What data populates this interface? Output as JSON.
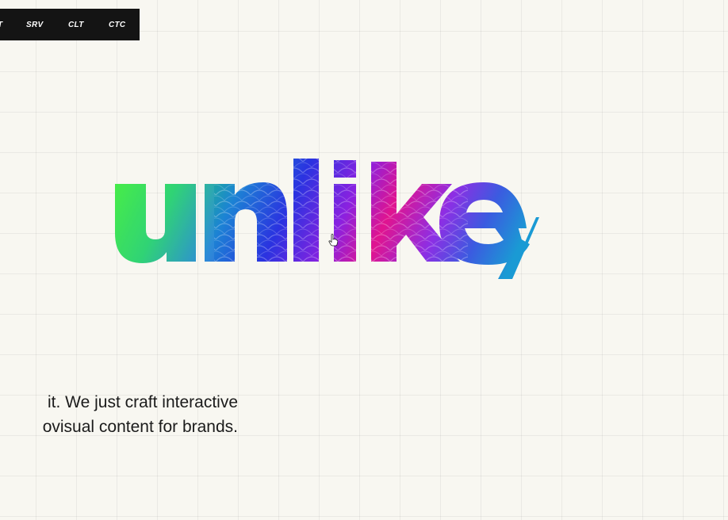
{
  "nav": {
    "items": [
      {
        "label": "T"
      },
      {
        "label": "SRV"
      },
      {
        "label": "CLT"
      },
      {
        "label": "CTC"
      }
    ]
  },
  "logo": {
    "text": "unlikely",
    "gradient": [
      "#35f22a",
      "#18c77f",
      "#1f6fd6",
      "#3227e0",
      "#b81ed9",
      "#e3139a",
      "#6a2fe4",
      "#1d86d6"
    ]
  },
  "tagline": {
    "line1": "it. We just craft interactive",
    "line2": "ovisual content for brands."
  },
  "icons": {
    "cursor": "hand-pointer-icon"
  },
  "colors": {
    "background": "#f8f7f1",
    "nav_background": "#141414",
    "text": "#1b1b1b"
  }
}
